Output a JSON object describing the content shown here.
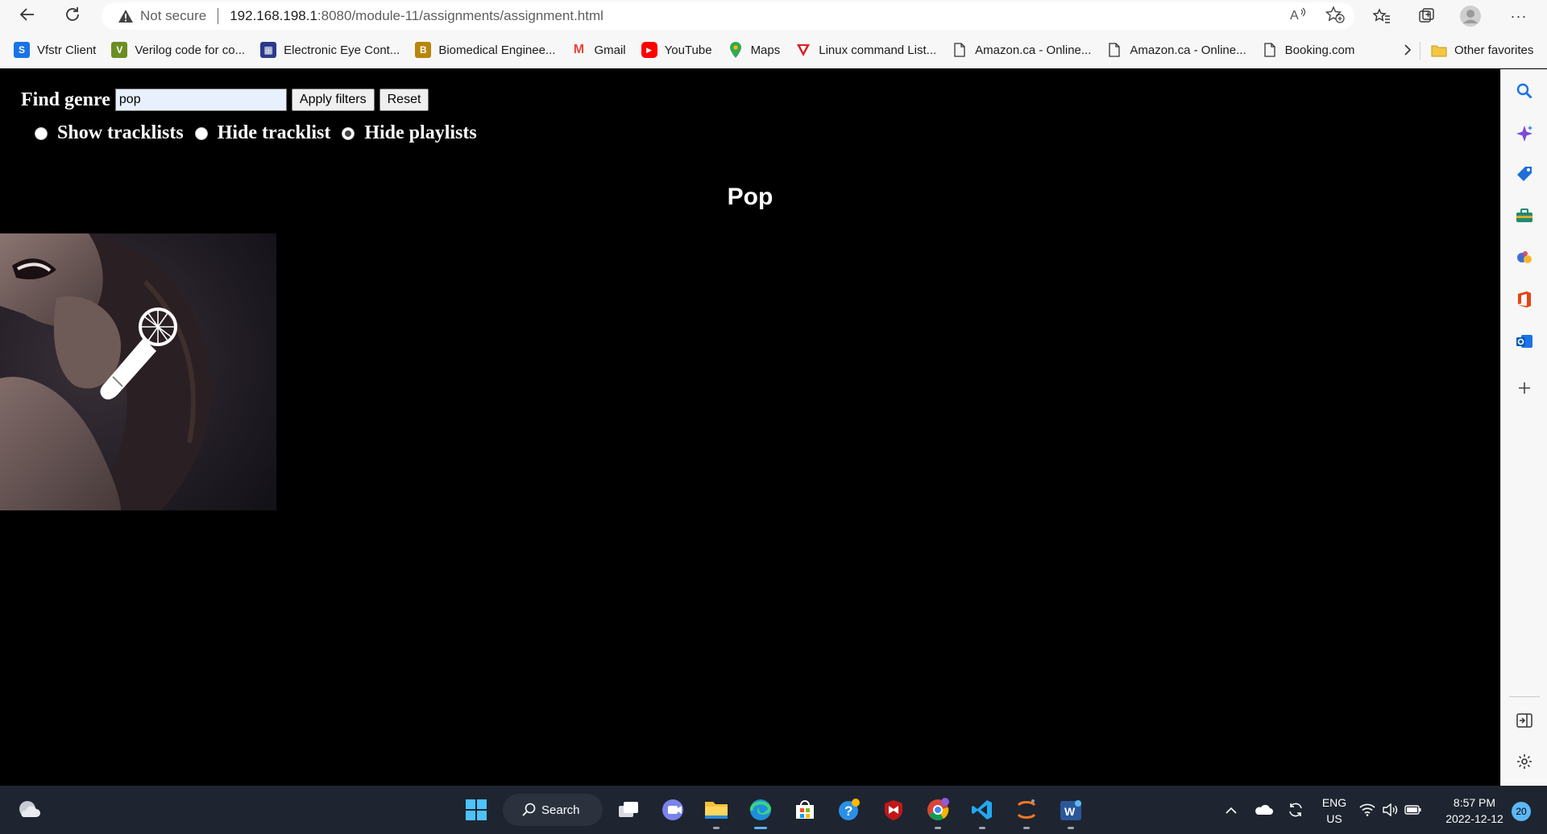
{
  "browser": {
    "security_label": "Not secure",
    "url_host": "192.168.198.1",
    "url_path": ":8080/module-11/assignments/assignment.html",
    "bookmarks": [
      {
        "label": "Vfstr Client",
        "icon": "vfstr-icon",
        "color": "#1a73e8",
        "glyph": "S"
      },
      {
        "label": "Verilog code for co...",
        "icon": "verilog-icon",
        "color": "#6b8e23",
        "glyph": "V"
      },
      {
        "label": "Electronic Eye Cont...",
        "icon": "grid-icon",
        "color": "#2b3a8c",
        "glyph": "▦"
      },
      {
        "label": "Biomedical Enginee...",
        "icon": "crest-icon",
        "color": "#b8860b",
        "glyph": "B"
      },
      {
        "label": "Gmail",
        "icon": "gmail-icon",
        "color": "#ea4335",
        "glyph": "M"
      },
      {
        "label": "YouTube",
        "icon": "youtube-icon",
        "color": "#ff0000",
        "glyph": "▶"
      },
      {
        "label": "Maps",
        "icon": "maps-icon",
        "color": "#34a853",
        "glyph": "●"
      },
      {
        "label": "Linux command List...",
        "icon": "tutorialspoint-icon",
        "color": "#d61f26",
        "glyph": "T"
      },
      {
        "label": "Amazon.ca - Online...",
        "icon": "page-icon",
        "color": "",
        "glyph": ""
      },
      {
        "label": "Amazon.ca - Online...",
        "icon": "page-icon",
        "color": "",
        "glyph": ""
      },
      {
        "label": "Booking.com",
        "icon": "page-icon",
        "color": "",
        "glyph": ""
      }
    ],
    "other_favorites": "Other favorites"
  },
  "page": {
    "find_label": "Find genre",
    "genre_value": "pop",
    "apply_label": "Apply filters",
    "reset_label": "Reset",
    "radios": [
      {
        "label": "Show tracklists",
        "checked": false
      },
      {
        "label": "Hide tracklist",
        "checked": false
      },
      {
        "label": "Hide playlists",
        "checked": true
      }
    ],
    "genre_title": "Pop"
  },
  "taskbar": {
    "search_label": "Search",
    "lang_top": "ENG",
    "lang_bottom": "US",
    "time": "8:57 PM",
    "date": "2022-12-12",
    "notifications": "20"
  }
}
